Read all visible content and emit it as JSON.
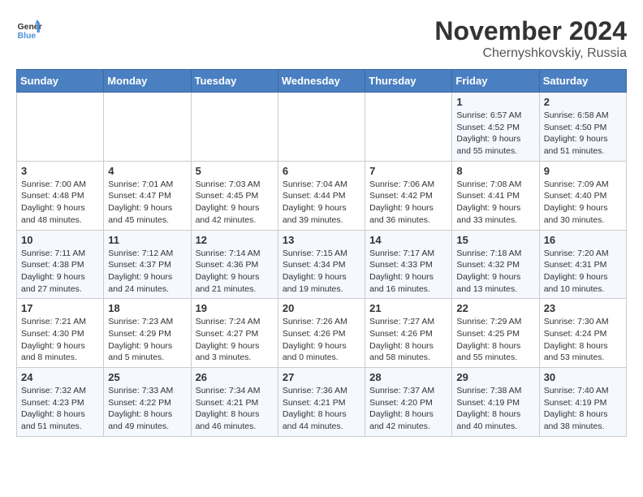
{
  "header": {
    "logo_line1": "General",
    "logo_line2": "Blue",
    "month_year": "November 2024",
    "location": "Chernyshkovskiy, Russia"
  },
  "weekdays": [
    "Sunday",
    "Monday",
    "Tuesday",
    "Wednesday",
    "Thursday",
    "Friday",
    "Saturday"
  ],
  "weeks": [
    [
      {
        "day": "",
        "info": ""
      },
      {
        "day": "",
        "info": ""
      },
      {
        "day": "",
        "info": ""
      },
      {
        "day": "",
        "info": ""
      },
      {
        "day": "",
        "info": ""
      },
      {
        "day": "1",
        "info": "Sunrise: 6:57 AM\nSunset: 4:52 PM\nDaylight: 9 hours\nand 55 minutes."
      },
      {
        "day": "2",
        "info": "Sunrise: 6:58 AM\nSunset: 4:50 PM\nDaylight: 9 hours\nand 51 minutes."
      }
    ],
    [
      {
        "day": "3",
        "info": "Sunrise: 7:00 AM\nSunset: 4:48 PM\nDaylight: 9 hours\nand 48 minutes."
      },
      {
        "day": "4",
        "info": "Sunrise: 7:01 AM\nSunset: 4:47 PM\nDaylight: 9 hours\nand 45 minutes."
      },
      {
        "day": "5",
        "info": "Sunrise: 7:03 AM\nSunset: 4:45 PM\nDaylight: 9 hours\nand 42 minutes."
      },
      {
        "day": "6",
        "info": "Sunrise: 7:04 AM\nSunset: 4:44 PM\nDaylight: 9 hours\nand 39 minutes."
      },
      {
        "day": "7",
        "info": "Sunrise: 7:06 AM\nSunset: 4:42 PM\nDaylight: 9 hours\nand 36 minutes."
      },
      {
        "day": "8",
        "info": "Sunrise: 7:08 AM\nSunset: 4:41 PM\nDaylight: 9 hours\nand 33 minutes."
      },
      {
        "day": "9",
        "info": "Sunrise: 7:09 AM\nSunset: 4:40 PM\nDaylight: 9 hours\nand 30 minutes."
      }
    ],
    [
      {
        "day": "10",
        "info": "Sunrise: 7:11 AM\nSunset: 4:38 PM\nDaylight: 9 hours\nand 27 minutes."
      },
      {
        "day": "11",
        "info": "Sunrise: 7:12 AM\nSunset: 4:37 PM\nDaylight: 9 hours\nand 24 minutes."
      },
      {
        "day": "12",
        "info": "Sunrise: 7:14 AM\nSunset: 4:36 PM\nDaylight: 9 hours\nand 21 minutes."
      },
      {
        "day": "13",
        "info": "Sunrise: 7:15 AM\nSunset: 4:34 PM\nDaylight: 9 hours\nand 19 minutes."
      },
      {
        "day": "14",
        "info": "Sunrise: 7:17 AM\nSunset: 4:33 PM\nDaylight: 9 hours\nand 16 minutes."
      },
      {
        "day": "15",
        "info": "Sunrise: 7:18 AM\nSunset: 4:32 PM\nDaylight: 9 hours\nand 13 minutes."
      },
      {
        "day": "16",
        "info": "Sunrise: 7:20 AM\nSunset: 4:31 PM\nDaylight: 9 hours\nand 10 minutes."
      }
    ],
    [
      {
        "day": "17",
        "info": "Sunrise: 7:21 AM\nSunset: 4:30 PM\nDaylight: 9 hours\nand 8 minutes."
      },
      {
        "day": "18",
        "info": "Sunrise: 7:23 AM\nSunset: 4:29 PM\nDaylight: 9 hours\nand 5 minutes."
      },
      {
        "day": "19",
        "info": "Sunrise: 7:24 AM\nSunset: 4:27 PM\nDaylight: 9 hours\nand 3 minutes."
      },
      {
        "day": "20",
        "info": "Sunrise: 7:26 AM\nSunset: 4:26 PM\nDaylight: 9 hours\nand 0 minutes."
      },
      {
        "day": "21",
        "info": "Sunrise: 7:27 AM\nSunset: 4:26 PM\nDaylight: 8 hours\nand 58 minutes."
      },
      {
        "day": "22",
        "info": "Sunrise: 7:29 AM\nSunset: 4:25 PM\nDaylight: 8 hours\nand 55 minutes."
      },
      {
        "day": "23",
        "info": "Sunrise: 7:30 AM\nSunset: 4:24 PM\nDaylight: 8 hours\nand 53 minutes."
      }
    ],
    [
      {
        "day": "24",
        "info": "Sunrise: 7:32 AM\nSunset: 4:23 PM\nDaylight: 8 hours\nand 51 minutes."
      },
      {
        "day": "25",
        "info": "Sunrise: 7:33 AM\nSunset: 4:22 PM\nDaylight: 8 hours\nand 49 minutes."
      },
      {
        "day": "26",
        "info": "Sunrise: 7:34 AM\nSunset: 4:21 PM\nDaylight: 8 hours\nand 46 minutes."
      },
      {
        "day": "27",
        "info": "Sunrise: 7:36 AM\nSunset: 4:21 PM\nDaylight: 8 hours\nand 44 minutes."
      },
      {
        "day": "28",
        "info": "Sunrise: 7:37 AM\nSunset: 4:20 PM\nDaylight: 8 hours\nand 42 minutes."
      },
      {
        "day": "29",
        "info": "Sunrise: 7:38 AM\nSunset: 4:19 PM\nDaylight: 8 hours\nand 40 minutes."
      },
      {
        "day": "30",
        "info": "Sunrise: 7:40 AM\nSunset: 4:19 PM\nDaylight: 8 hours\nand 38 minutes."
      }
    ]
  ]
}
